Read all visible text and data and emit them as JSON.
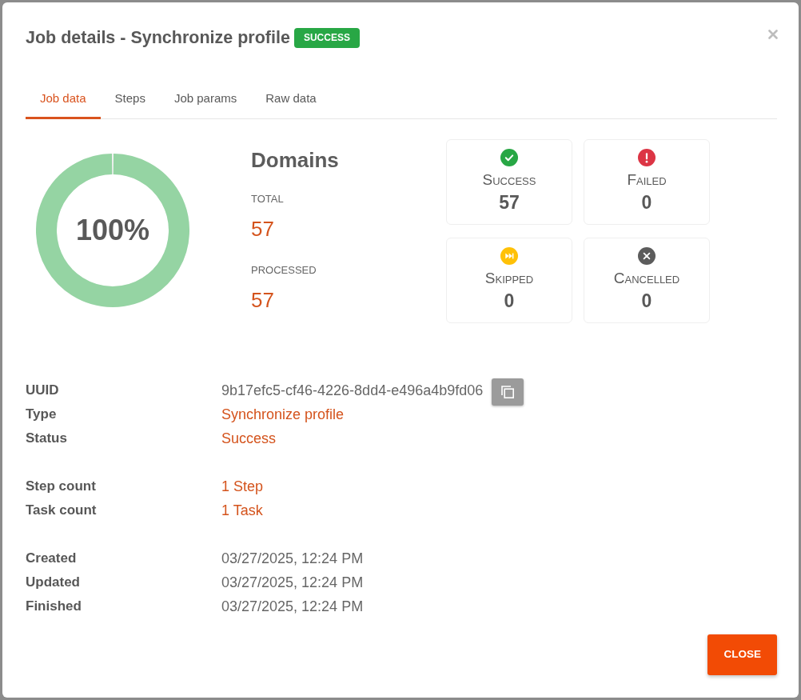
{
  "dialog": {
    "title": "Job details - Synchronize profile",
    "badge": "SUCCESS",
    "close_button": "CLOSE"
  },
  "tabs": [
    {
      "label": "Job data",
      "selected": true
    },
    {
      "label": "Steps",
      "selected": false
    },
    {
      "label": "Job params",
      "selected": false
    },
    {
      "label": "Raw data",
      "selected": false
    }
  ],
  "progress": {
    "level": 1,
    "reading": "100%"
  },
  "domains": {
    "title": "Domains",
    "stats": [
      {
        "label": "TOTAL",
        "value": "57"
      },
      {
        "label": "PROCESSED",
        "value": "57"
      }
    ]
  },
  "result_cards": [
    {
      "kind": "success",
      "label": "Success",
      "value": "57",
      "color": "#28a745"
    },
    {
      "kind": "failed",
      "label": "Failed",
      "value": "0",
      "color": "#dc3545"
    },
    {
      "kind": "skipped",
      "label": "Skipped",
      "value": "0",
      "color": "#ffc107"
    },
    {
      "kind": "cancelled",
      "label": "Cancelled",
      "value": "0",
      "color": "#5c5c5c"
    }
  ],
  "detail_groups": [
    {
      "rows": [
        {
          "label": "UUID",
          "value": "9b17efc5-cf46-4226-8dd4-e496a4b9fd06",
          "kind": "copy"
        },
        {
          "label": "Type",
          "value": "Synchronize profile",
          "kind": "accent"
        },
        {
          "label": "Status",
          "value": "Success",
          "kind": "accent"
        }
      ]
    },
    {
      "rows": [
        {
          "label": "Step count",
          "value": "1 Step",
          "kind": "accent"
        },
        {
          "label": "Task count",
          "value": "1 Task",
          "kind": "accent"
        }
      ]
    },
    {
      "rows": [
        {
          "label": "Created",
          "value": "03/27/2025, 12:24 PM",
          "kind": "text"
        },
        {
          "label": "Updated",
          "value": "03/27/2025, 12:24 PM",
          "kind": "text"
        },
        {
          "label": "Finished",
          "value": "03/27/2025, 12:24 PM",
          "kind": "text"
        }
      ]
    }
  ]
}
